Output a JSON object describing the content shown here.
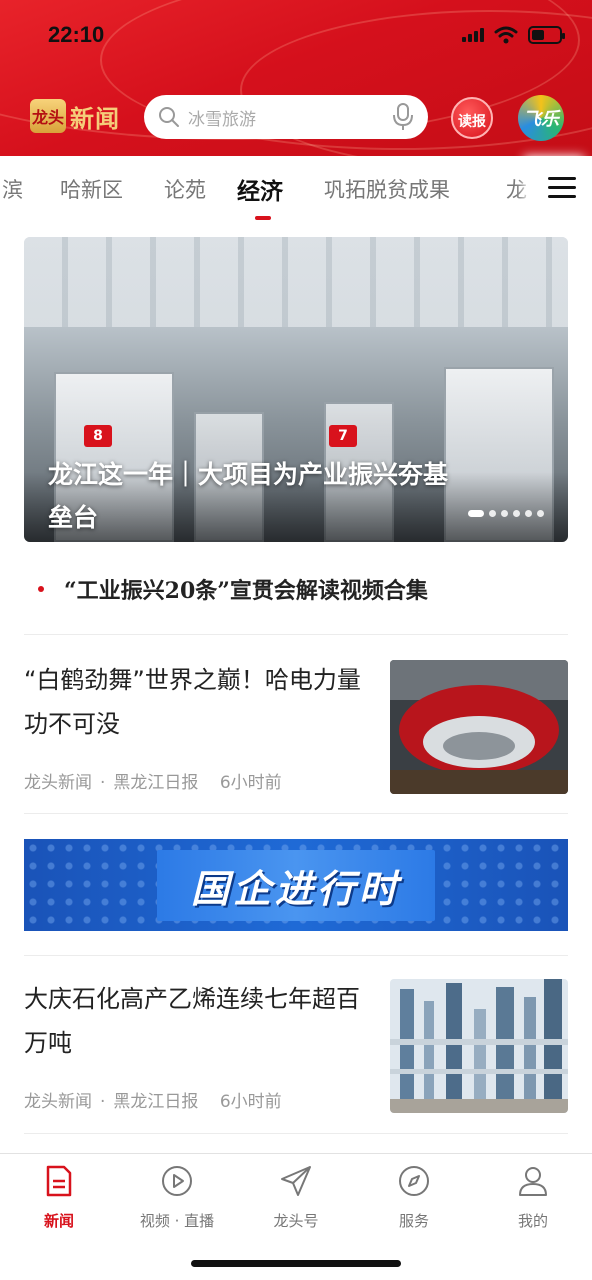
{
  "status_bar": {
    "time": "22:10"
  },
  "header": {
    "logo_badge": "龙头",
    "logo_text": "新闻",
    "search_placeholder": "冰雪旅游",
    "read_button": "读报",
    "fly_button": "飞乐"
  },
  "tabs": [
    {
      "label": "滨",
      "active": false
    },
    {
      "label": "哈新区",
      "active": false
    },
    {
      "label": "论苑",
      "active": false
    },
    {
      "label": "经济",
      "active": true
    },
    {
      "label": "巩拓脱贫成果",
      "active": false
    },
    {
      "label": "龙",
      "active": false
    }
  ],
  "hero": {
    "title": "龙江这一年｜大项目为产业振兴夯基垒台",
    "machine_tags": [
      "8",
      "7"
    ],
    "slide_count": 6,
    "active_slide": 1
  },
  "headline": {
    "text": "“工业振兴20条”宣贯会解读视频合集"
  },
  "articles": [
    {
      "title": "“白鹤劲舞”世界之巅！哈电力量功不可没",
      "source": "龙头新闻",
      "paper": "黑龙江日报",
      "time": "6小时前"
    },
    {
      "title": "大庆石化高产乙烯连续七年超百万吨",
      "source": "龙头新闻",
      "paper": "黑龙江日报",
      "time": "6小时前"
    }
  ],
  "banner": {
    "text": "国企进行时"
  },
  "bottom_nav": [
    {
      "label": "新闻",
      "icon": "news-icon",
      "active": true
    },
    {
      "label": "视频 · 直播",
      "icon": "play-icon",
      "active": false
    },
    {
      "label": "龙头号",
      "icon": "paper-plane-icon",
      "active": false
    },
    {
      "label": "服务",
      "icon": "compass-icon",
      "active": false
    },
    {
      "label": "我的",
      "icon": "user-icon",
      "active": false
    }
  ],
  "colors": {
    "brand_red": "#d8121c",
    "banner_blue": "#1f6ad6"
  }
}
